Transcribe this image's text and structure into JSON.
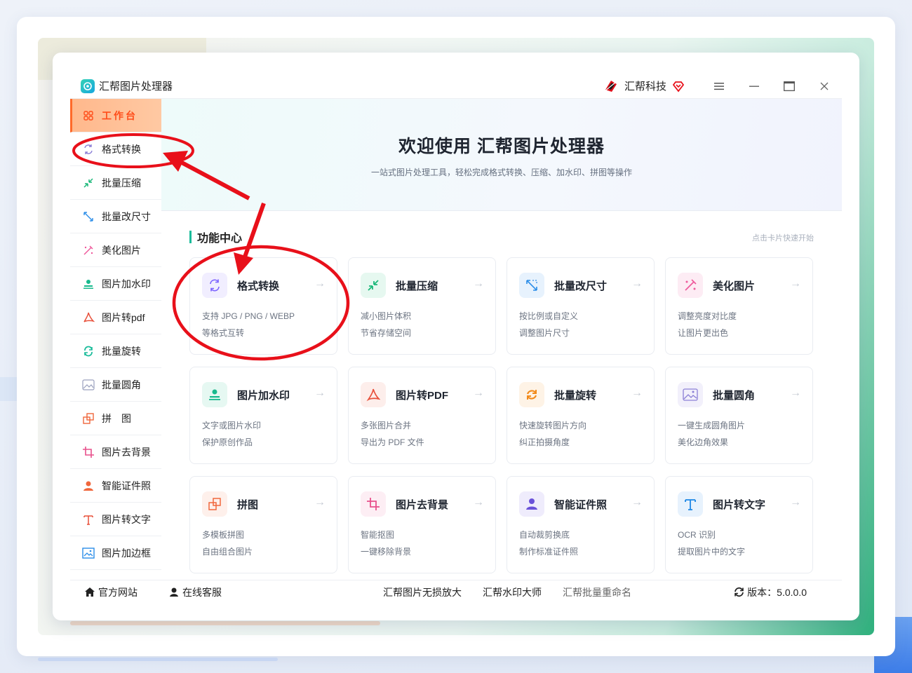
{
  "app": {
    "title": "汇帮图片处理器",
    "brand": "汇帮科技"
  },
  "window_controls": {
    "menu": "≡",
    "minimize": "—",
    "maximize": "▭",
    "close": "✕"
  },
  "sidebar": {
    "items": [
      {
        "label": "工作台",
        "icon": "grid-icon",
        "active": true
      },
      {
        "label": "格式转换",
        "icon": "convert-icon"
      },
      {
        "label": "批量压缩",
        "icon": "compress-icon"
      },
      {
        "label": "批量改尺寸",
        "icon": "resize-icon"
      },
      {
        "label": "美化图片",
        "icon": "beautify-icon"
      },
      {
        "label": "图片加水印",
        "icon": "watermark-icon"
      },
      {
        "label": "图片转pdf",
        "icon": "pdf-icon"
      },
      {
        "label": "批量旋转",
        "icon": "rotate-icon"
      },
      {
        "label": "批量圆角",
        "icon": "round-corner-icon"
      },
      {
        "label": "拼　图",
        "icon": "collage-icon"
      },
      {
        "label": "图片去背景",
        "icon": "crop-icon"
      },
      {
        "label": "智能证件照",
        "icon": "person-icon"
      },
      {
        "label": "图片转文字",
        "icon": "text-icon"
      },
      {
        "label": "图片加边框",
        "icon": "frame-icon"
      }
    ]
  },
  "hero": {
    "title": "欢迎使用 汇帮图片处理器",
    "subtitle": "一站式图片处理工具，轻松完成格式转换、压缩、加水印、拼图等操作"
  },
  "section": {
    "title": "功能中心",
    "hint": "点击卡片快速开始"
  },
  "cards": [
    {
      "title": "格式转换",
      "line1": "支持 JPG / PNG / WEBP",
      "line2": "等格式互转",
      "icon": "convert-icon",
      "color": "#7b61ff",
      "bg": "#f1eeff"
    },
    {
      "title": "批量压缩",
      "line1": "减小图片体积",
      "line2": "节省存储空间",
      "icon": "compress-icon",
      "color": "#1bb87a",
      "bg": "#e6f8f0"
    },
    {
      "title": "批量改尺寸",
      "line1": "按比例或自定义",
      "line2": "调整图片尺寸",
      "icon": "resize-icon",
      "color": "#2b8de8",
      "bg": "#e7f2fd"
    },
    {
      "title": "美化图片",
      "line1": "调整亮度对比度",
      "line2": "让图片更出色",
      "icon": "beautify-icon",
      "color": "#ef5a9c",
      "bg": "#fdecf4"
    },
    {
      "title": "图片加水印",
      "line1": "文字或图片水印",
      "line2": "保护原创作品",
      "icon": "watermark-icon",
      "color": "#18b98d",
      "bg": "#e6f8f2"
    },
    {
      "title": "图片转PDF",
      "line1": "多张图片合并",
      "line2": "导出为 PDF 文件",
      "icon": "pdf-icon",
      "color": "#e8503a",
      "bg": "#fdeeeb"
    },
    {
      "title": "批量旋转",
      "line1": "快速旋转图片方向",
      "line2": "纠正拍摄角度",
      "icon": "rotate-icon",
      "color": "#f28b1c",
      "bg": "#fef3e6"
    },
    {
      "title": "批量圆角",
      "line1": "一键生成圆角图片",
      "line2": "美化边角效果",
      "icon": "round-corner-icon",
      "color": "#8b7fd6",
      "bg": "#f2f0fb"
    },
    {
      "title": "拼图",
      "line1": "多模板拼图",
      "line2": "自由组合图片",
      "icon": "collage-icon",
      "color": "#f0673c",
      "bg": "#fef0eb"
    },
    {
      "title": "图片去背景",
      "line1": "智能抠图",
      "line2": "一键移除背景",
      "icon": "crop-icon",
      "color": "#e8508c",
      "bg": "#fdeef4"
    },
    {
      "title": "智能证件照",
      "line1": "自动裁剪换底",
      "line2": "制作标准证件照",
      "icon": "person-icon",
      "color": "#6a52d9",
      "bg": "#efecfc"
    },
    {
      "title": "图片转文字",
      "line1": "OCR 识别",
      "line2": "提取图片中的文字",
      "icon": "text-icon",
      "color": "#1e88e5",
      "bg": "#e7f2fd"
    }
  ],
  "footer": {
    "website": "官方网站",
    "service": "在线客服",
    "link1": "汇帮图片无损放大",
    "link2": "汇帮水印大师",
    "link3": "汇帮批量重命名",
    "version": "版本：5.0.0.0"
  },
  "colors": {
    "accent": "#1bbc9b",
    "active_tab": "#ff4d1a",
    "annotation": "#e8101a"
  }
}
